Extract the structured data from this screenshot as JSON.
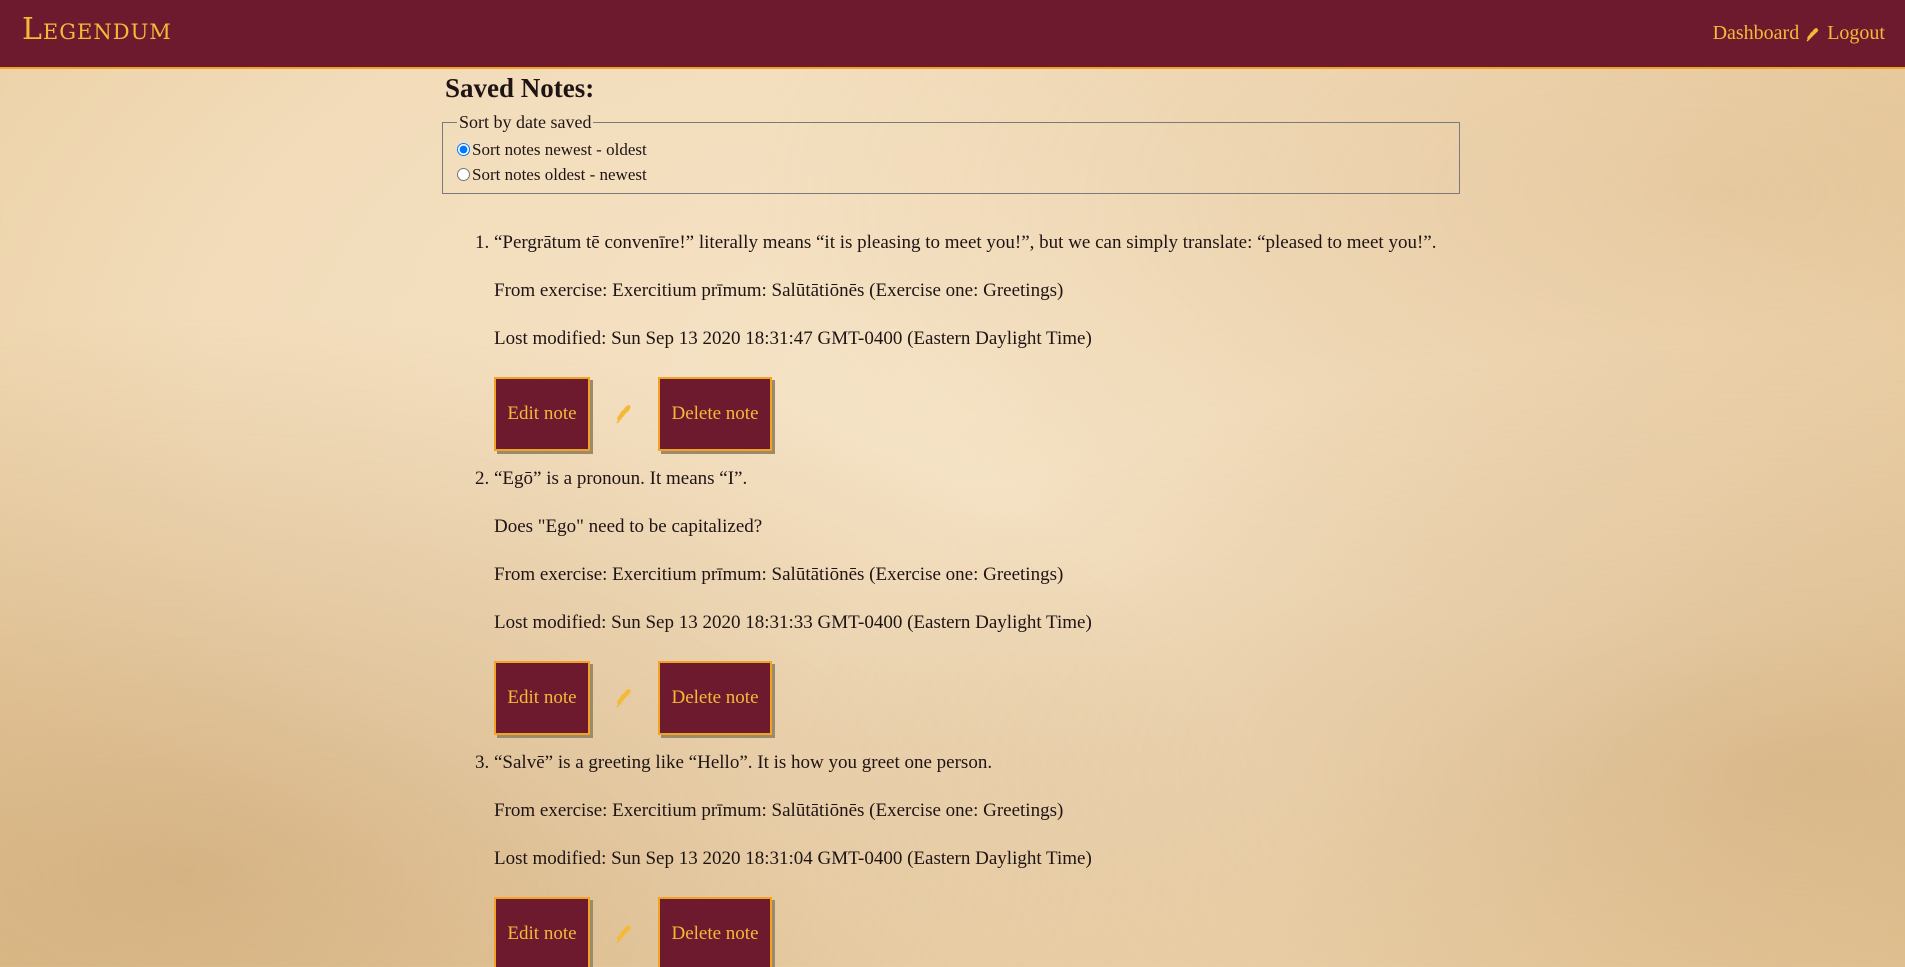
{
  "nav": {
    "brand": "Legendum",
    "dashboard": "Dashboard",
    "logout": "Logout",
    "separator_icon": "wheat-icon"
  },
  "page": {
    "title": "Saved Notes:"
  },
  "sort": {
    "legend": "Sort by date saved",
    "options": [
      {
        "label": "Sort notes newest - oldest",
        "checked": true
      },
      {
        "label": "Sort notes oldest - newest",
        "checked": false
      }
    ]
  },
  "notes": [
    {
      "text": "“Pergrātum tē convenīre!” literally means “it is pleasing to meet you!”, but we can simply translate: “pleased to meet you!”.",
      "question": "",
      "exercise": "From exercise: Exercitium prīmum: Salūtātiōnēs (Exercise one: Greetings)",
      "modified": "Lost modified: Sun Sep 13 2020 18:31:47 GMT-0400 (Eastern Daylight Time)",
      "edit_label": "Edit note",
      "delete_label": "Delete note"
    },
    {
      "text": "“Egō” is a pronoun. It means “I”.",
      "question": "Does \"Ego\" need to be capitalized?",
      "exercise": "From exercise: Exercitium prīmum: Salūtātiōnēs (Exercise one: Greetings)",
      "modified": "Lost modified: Sun Sep 13 2020 18:31:33 GMT-0400 (Eastern Daylight Time)",
      "edit_label": "Edit note",
      "delete_label": "Delete note"
    },
    {
      "text": "“Salvē” is a greeting like “Hello”. It is how you greet one person.",
      "question": "",
      "exercise": "From exercise: Exercitium prīmum: Salūtātiōnēs (Exercise one: Greetings)",
      "modified": "Lost modified: Sun Sep 13 2020 18:31:04 GMT-0400 (Eastern Daylight Time)",
      "edit_label": "Edit note",
      "delete_label": "Delete note"
    }
  ],
  "colors": {
    "nav_bg": "#6e1a2e",
    "accent": "#f5b93a",
    "border": "#f1a326"
  }
}
